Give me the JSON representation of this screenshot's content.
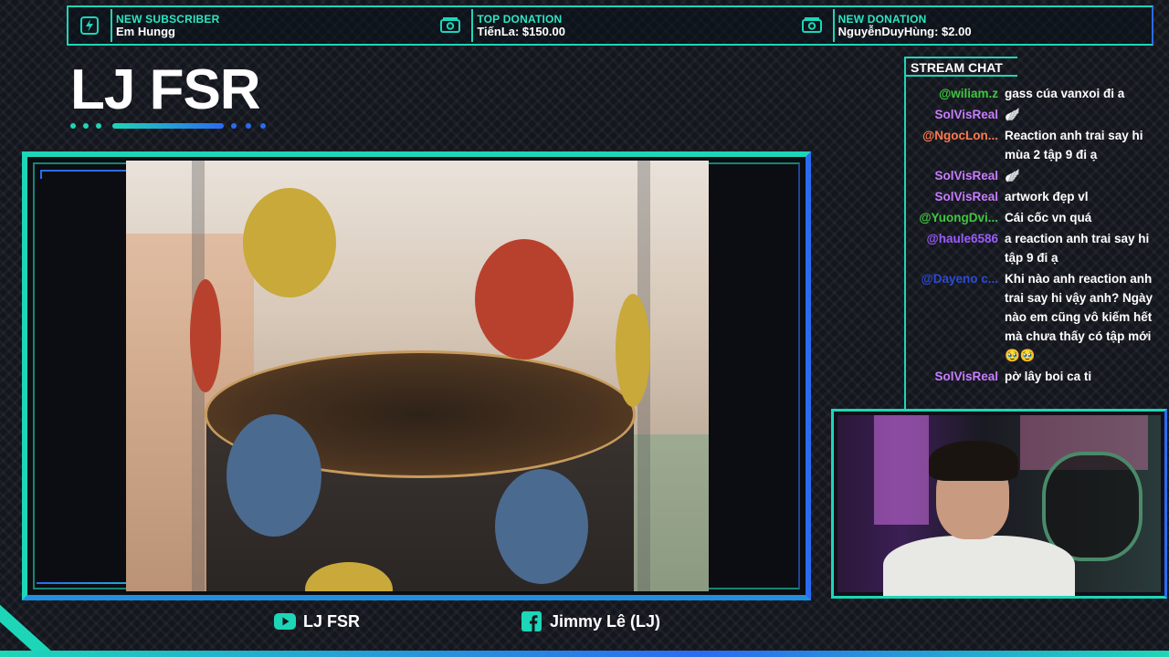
{
  "alerts": [
    {
      "title": "NEW SUBSCRIBER",
      "value": "Em Hungg",
      "icon": "bolt-icon"
    },
    {
      "title": "TOP DONATION",
      "value": "TiếnLa: $150.00",
      "icon": "money-icon"
    },
    {
      "title": "NEW DONATION",
      "value": "NguyễnDuyHùng: $2.00",
      "icon": "money-icon"
    }
  ],
  "channel": {
    "title": "LJ FSR"
  },
  "chat": {
    "header": "STREAM CHAT",
    "messages": [
      {
        "user": "@wiliam.z",
        "color": "#3fc73f",
        "text": "gass cúa vanxoi đi a"
      },
      {
        "user": "SolVisReal",
        "color": "#c77dff",
        "text": "🪽"
      },
      {
        "user": "@NgocLon...",
        "color": "#ff7a4d",
        "text": "Reaction anh trai say hi mùa 2 tập 9 đi ạ"
      },
      {
        "user": "SolVisReal",
        "color": "#c77dff",
        "text": "🪽"
      },
      {
        "user": "SolVisReal",
        "color": "#c77dff",
        "text": "artwork đẹp vl"
      },
      {
        "user": "@YuongDvi...",
        "color": "#3fc73f",
        "text": "Cái cốc vn quá"
      },
      {
        "user": "@haule6586",
        "color": "#9b5cff",
        "text": "a reaction anh trai say hi tập 9 đi ạ"
      },
      {
        "user": "@Dayeno c...",
        "color": "#2b4bd6",
        "text": "Khi nào anh reaction anh trai say hi vậy anh? Ngày nào em cũng vô kiếm hết mà chưa thấy có tập mới 🥹🥹"
      },
      {
        "user": "SolVisReal",
        "color": "#c77dff",
        "text": "pờ lây boi ca ti"
      }
    ]
  },
  "socials": [
    {
      "platform": "youtube",
      "label": "LJ FSR",
      "icon": "youtube-icon",
      "color": "#1dd6b8"
    },
    {
      "platform": "facebook",
      "label": "Jimmy Lê (LJ)",
      "icon": "facebook-icon",
      "color": "#1dd6b8"
    }
  ],
  "colors": {
    "accent": "#1dd6b8",
    "accent2": "#2b6bf2",
    "background": "#14161d"
  }
}
